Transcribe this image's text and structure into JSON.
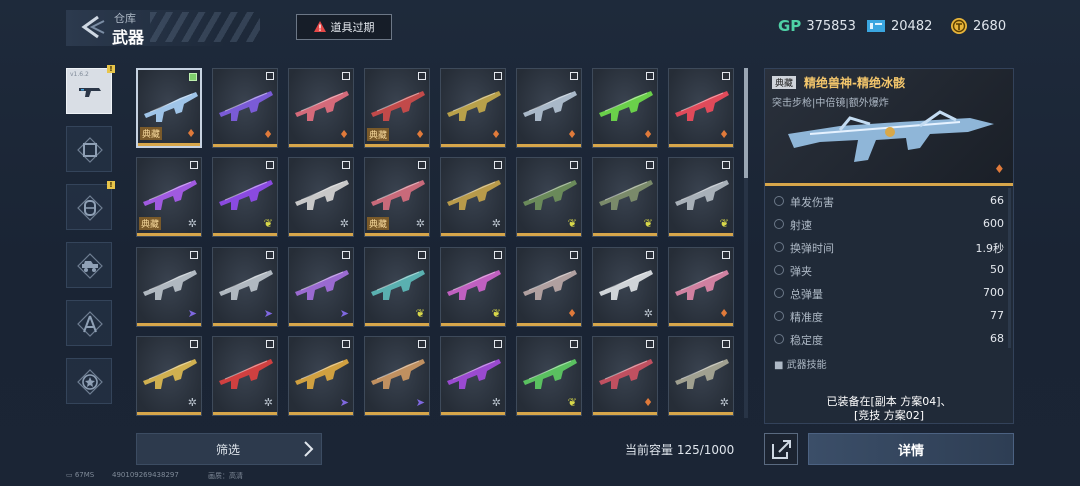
{
  "header": {
    "section": "仓库",
    "title": "武器",
    "expire_label": "道具过期"
  },
  "currencies": [
    {
      "icon": "gp-icon",
      "symbol": "GP",
      "value": "375853"
    },
    {
      "icon": "ticket-icon",
      "value": "20482"
    },
    {
      "icon": "coin-icon",
      "value": "2680"
    }
  ],
  "tabs": [
    {
      "name": "weapon",
      "icon": "gun-icon",
      "badge": "!",
      "version": "v1.6.2",
      "selected": true
    },
    {
      "name": "outfit",
      "icon": "frame-icon"
    },
    {
      "name": "item",
      "icon": "capsule-icon",
      "badge": "!"
    },
    {
      "name": "vehicle",
      "icon": "vehicle-icon"
    },
    {
      "name": "pilot",
      "icon": "compass-icon"
    },
    {
      "name": "medal",
      "icon": "star-badge-icon"
    }
  ],
  "weapons": [
    {
      "tag": "典藏",
      "checked": true,
      "color": "#9fc4e8",
      "rank": "fire"
    },
    {
      "color": "#7a5bd6",
      "rank": "fire"
    },
    {
      "color": "#d46a7a",
      "rank": "fire"
    },
    {
      "tag": "典藏",
      "color": "#c24a4a",
      "rank": "fire"
    },
    {
      "color": "#b8a04a",
      "rank": "fire"
    },
    {
      "color": "#a9b8c8",
      "rank": "fire"
    },
    {
      "color": "#6ad04a",
      "rank": "fire"
    },
    {
      "color": "#e04a5a",
      "rank": "fire"
    },
    {
      "tag": "典藏",
      "color": "#a05ae0",
      "rank": "star"
    },
    {
      "color": "#8a4ae0",
      "rank": "leaf"
    },
    {
      "color": "#c8c8c8",
      "rank": "star"
    },
    {
      "tag": "典藏",
      "color": "#c86a7a",
      "rank": "star"
    },
    {
      "color": "#b89a4a",
      "rank": "star"
    },
    {
      "color": "#6a8a5a",
      "rank": "leaf"
    },
    {
      "color": "#7a8a6a",
      "rank": "leaf"
    },
    {
      "color": "#a8b0b8",
      "rank": "leaf"
    },
    {
      "color": "#b0b8c0",
      "rank": "arrow"
    },
    {
      "color": "#b0b8c0",
      "rank": "arrow"
    },
    {
      "color": "#9a6ad0",
      "rank": "arrow"
    },
    {
      "color": "#5ab0b0",
      "rank": "leaf"
    },
    {
      "color": "#c060c0",
      "rank": "leaf"
    },
    {
      "color": "#b0a0a0",
      "rank": "fire"
    },
    {
      "color": "#d0d4d8",
      "rank": "star"
    },
    {
      "color": "#d080a0",
      "rank": "fire"
    },
    {
      "color": "#d0b050",
      "rank": "star"
    },
    {
      "color": "#d04040",
      "rank": "star"
    },
    {
      "color": "#d0a040",
      "rank": "arrow"
    },
    {
      "color": "#c09060",
      "rank": "arrow"
    },
    {
      "color": "#9a4ad0",
      "rank": "star"
    },
    {
      "color": "#5ac060",
      "rank": "leaf"
    },
    {
      "color": "#c05060",
      "rank": "fire"
    },
    {
      "color": "#a0a090",
      "rank": "star"
    }
  ],
  "filter_label": "筛选",
  "capacity_label": "当前容量 125/1000",
  "detail": {
    "tag": "典藏",
    "name": "精绝兽神-精绝冰骸",
    "subtitle": "突击步枪|中倍镜|额外爆炸",
    "stats": [
      {
        "label": "单发伤害",
        "value": "66"
      },
      {
        "label": "射速",
        "value": "600"
      },
      {
        "label": "换弹时间",
        "value": "1.9秒"
      },
      {
        "label": "弹夹",
        "value": "50"
      },
      {
        "label": "总弹量",
        "value": "700"
      },
      {
        "label": "精准度",
        "value": "77"
      },
      {
        "label": "稳定度",
        "value": "68"
      }
    ],
    "skill_label": "武器技能",
    "equipped_line1": "已装备在[副本 方案04]、",
    "equipped_line2": "[竞技 方案02]",
    "detail_button": "详情"
  },
  "footer": {
    "ping": "67MS",
    "uid": "490109269438297",
    "quality": "画质：高清"
  },
  "colors": {
    "gold": "#d7a64a",
    "accent": "#f2c56b",
    "gp": "#4fd1a6"
  }
}
